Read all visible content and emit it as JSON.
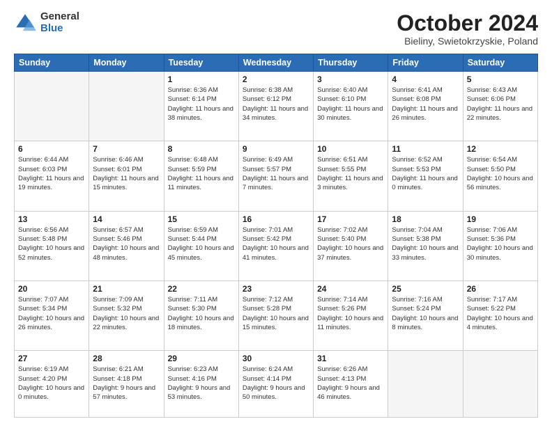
{
  "logo": {
    "general": "General",
    "blue": "Blue"
  },
  "header": {
    "month": "October 2024",
    "location": "Bieliny, Swietokrzyskie, Poland"
  },
  "weekdays": [
    "Sunday",
    "Monday",
    "Tuesday",
    "Wednesday",
    "Thursday",
    "Friday",
    "Saturday"
  ],
  "weeks": [
    [
      {
        "day": "",
        "info": ""
      },
      {
        "day": "",
        "info": ""
      },
      {
        "day": "1",
        "info": "Sunrise: 6:36 AM\nSunset: 6:14 PM\nDaylight: 11 hours and 38 minutes."
      },
      {
        "day": "2",
        "info": "Sunrise: 6:38 AM\nSunset: 6:12 PM\nDaylight: 11 hours and 34 minutes."
      },
      {
        "day": "3",
        "info": "Sunrise: 6:40 AM\nSunset: 6:10 PM\nDaylight: 11 hours and 30 minutes."
      },
      {
        "day": "4",
        "info": "Sunrise: 6:41 AM\nSunset: 6:08 PM\nDaylight: 11 hours and 26 minutes."
      },
      {
        "day": "5",
        "info": "Sunrise: 6:43 AM\nSunset: 6:06 PM\nDaylight: 11 hours and 22 minutes."
      }
    ],
    [
      {
        "day": "6",
        "info": "Sunrise: 6:44 AM\nSunset: 6:03 PM\nDaylight: 11 hours and 19 minutes."
      },
      {
        "day": "7",
        "info": "Sunrise: 6:46 AM\nSunset: 6:01 PM\nDaylight: 11 hours and 15 minutes."
      },
      {
        "day": "8",
        "info": "Sunrise: 6:48 AM\nSunset: 5:59 PM\nDaylight: 11 hours and 11 minutes."
      },
      {
        "day": "9",
        "info": "Sunrise: 6:49 AM\nSunset: 5:57 PM\nDaylight: 11 hours and 7 minutes."
      },
      {
        "day": "10",
        "info": "Sunrise: 6:51 AM\nSunset: 5:55 PM\nDaylight: 11 hours and 3 minutes."
      },
      {
        "day": "11",
        "info": "Sunrise: 6:52 AM\nSunset: 5:53 PM\nDaylight: 11 hours and 0 minutes."
      },
      {
        "day": "12",
        "info": "Sunrise: 6:54 AM\nSunset: 5:50 PM\nDaylight: 10 hours and 56 minutes."
      }
    ],
    [
      {
        "day": "13",
        "info": "Sunrise: 6:56 AM\nSunset: 5:48 PM\nDaylight: 10 hours and 52 minutes."
      },
      {
        "day": "14",
        "info": "Sunrise: 6:57 AM\nSunset: 5:46 PM\nDaylight: 10 hours and 48 minutes."
      },
      {
        "day": "15",
        "info": "Sunrise: 6:59 AM\nSunset: 5:44 PM\nDaylight: 10 hours and 45 minutes."
      },
      {
        "day": "16",
        "info": "Sunrise: 7:01 AM\nSunset: 5:42 PM\nDaylight: 10 hours and 41 minutes."
      },
      {
        "day": "17",
        "info": "Sunrise: 7:02 AM\nSunset: 5:40 PM\nDaylight: 10 hours and 37 minutes."
      },
      {
        "day": "18",
        "info": "Sunrise: 7:04 AM\nSunset: 5:38 PM\nDaylight: 10 hours and 33 minutes."
      },
      {
        "day": "19",
        "info": "Sunrise: 7:06 AM\nSunset: 5:36 PM\nDaylight: 10 hours and 30 minutes."
      }
    ],
    [
      {
        "day": "20",
        "info": "Sunrise: 7:07 AM\nSunset: 5:34 PM\nDaylight: 10 hours and 26 minutes."
      },
      {
        "day": "21",
        "info": "Sunrise: 7:09 AM\nSunset: 5:32 PM\nDaylight: 10 hours and 22 minutes."
      },
      {
        "day": "22",
        "info": "Sunrise: 7:11 AM\nSunset: 5:30 PM\nDaylight: 10 hours and 18 minutes."
      },
      {
        "day": "23",
        "info": "Sunrise: 7:12 AM\nSunset: 5:28 PM\nDaylight: 10 hours and 15 minutes."
      },
      {
        "day": "24",
        "info": "Sunrise: 7:14 AM\nSunset: 5:26 PM\nDaylight: 10 hours and 11 minutes."
      },
      {
        "day": "25",
        "info": "Sunrise: 7:16 AM\nSunset: 5:24 PM\nDaylight: 10 hours and 8 minutes."
      },
      {
        "day": "26",
        "info": "Sunrise: 7:17 AM\nSunset: 5:22 PM\nDaylight: 10 hours and 4 minutes."
      }
    ],
    [
      {
        "day": "27",
        "info": "Sunrise: 6:19 AM\nSunset: 4:20 PM\nDaylight: 10 hours and 0 minutes."
      },
      {
        "day": "28",
        "info": "Sunrise: 6:21 AM\nSunset: 4:18 PM\nDaylight: 9 hours and 57 minutes."
      },
      {
        "day": "29",
        "info": "Sunrise: 6:23 AM\nSunset: 4:16 PM\nDaylight: 9 hours and 53 minutes."
      },
      {
        "day": "30",
        "info": "Sunrise: 6:24 AM\nSunset: 4:14 PM\nDaylight: 9 hours and 50 minutes."
      },
      {
        "day": "31",
        "info": "Sunrise: 6:26 AM\nSunset: 4:13 PM\nDaylight: 9 hours and 46 minutes."
      },
      {
        "day": "",
        "info": ""
      },
      {
        "day": "",
        "info": ""
      }
    ]
  ]
}
